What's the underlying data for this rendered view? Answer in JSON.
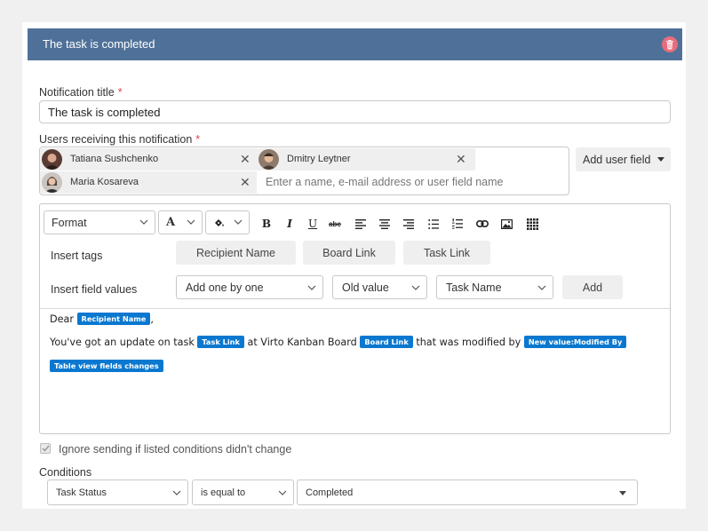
{
  "header": {
    "title": "The task is completed"
  },
  "notification_title": {
    "label": "Notification title",
    "required_mark": "*",
    "value": "The task is completed"
  },
  "users": {
    "label": "Users receiving this notification",
    "required_mark": "*",
    "chips": [
      {
        "name": "Tatiana Sushchenko"
      },
      {
        "name": "Dmitry Leytner"
      },
      {
        "name": "Maria Kosareva"
      }
    ],
    "remove_symbol": "✕",
    "placeholder": "Enter a name, e-mail address or user field name",
    "add_user_field_label": "Add user field"
  },
  "toolbar": {
    "format_label": "Format",
    "font_size_glyph": "A",
    "bold": "B",
    "italic": "I",
    "underline": "U",
    "strike": "abc"
  },
  "insert_tags": {
    "label": "Insert tags",
    "buttons": [
      "Recipient Name",
      "Board Link",
      "Task Link"
    ]
  },
  "insert_field_values": {
    "label": "Insert field values",
    "field_select": "Add one by one",
    "value_type_select": "Old value",
    "column_select": "Task Name",
    "add_button": "Add"
  },
  "message": {
    "greeting": "Dear",
    "recipient_tag": "Recipient Name",
    "comma": ",",
    "line2_text1": "You've got an update on task",
    "task_link_tag": "Task Link",
    "line2_text2": "at Virto Kanban Board",
    "board_link_tag": "Board Link",
    "line2_text3": "that was modified by",
    "modified_by_tag": "New value:Modified By",
    "table_changes_tag": "Table view fields changes"
  },
  "ignore_option": {
    "label": "Ignore sending if listed conditions didn't change",
    "checked": true
  },
  "conditions": {
    "label": "Conditions",
    "field": "Task Status",
    "operator": "is equal to",
    "value": "Completed"
  },
  "colors": {
    "header": "#4f7199",
    "accent_tag": "#0b78d0",
    "delete": "#e86d7c",
    "required": "#e2434f"
  }
}
